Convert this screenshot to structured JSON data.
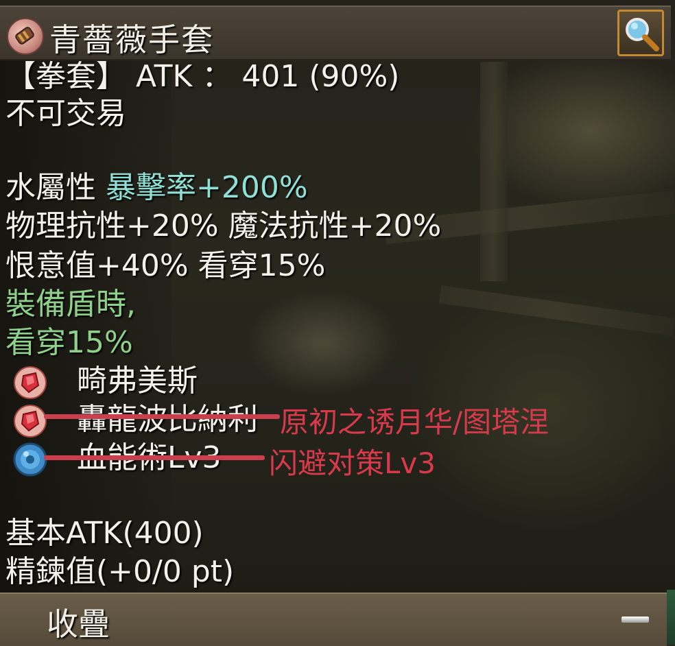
{
  "header": {
    "title": "青薔薇手套",
    "item_icon": "gauntlet-icon",
    "search_icon": "magnifier-icon"
  },
  "stats": {
    "type_line": "【拳套】 ATK ： 401 (90%)",
    "trade_status": "不可交易",
    "element_label": "水屬性",
    "element_bonus": "暴擊率+200%",
    "resist_line": "物理抗性+20% 魔法抗性+20%",
    "aggro_line": "恨意值+40% 看穿15%",
    "shield_condition": "裝備盾時,",
    "shield_bonus": "看穿15%"
  },
  "slots": [
    {
      "icon": "red-crystal-icon",
      "label": "畸弗美斯"
    },
    {
      "icon": "red-crystal-icon",
      "label": "轟龍波比納利"
    },
    {
      "icon": "blue-orb-icon",
      "label": "血能術Lv3"
    }
  ],
  "annotations": {
    "note_1": "原初之诱月华/图塔涅",
    "note_2": "闪避对策Lv3",
    "color": "#d83a4c"
  },
  "base": {
    "base_atk": "基本ATK(400)",
    "refine": "精鍊值(+0/0 pt)"
  },
  "footer": {
    "collapse_label": "收疊",
    "minus_icon": "minus-icon"
  },
  "colors": {
    "text": "#f3f1ea",
    "cyan": "#8fe0d6",
    "green": "#8fd08a",
    "search_border": "#c48a30"
  }
}
